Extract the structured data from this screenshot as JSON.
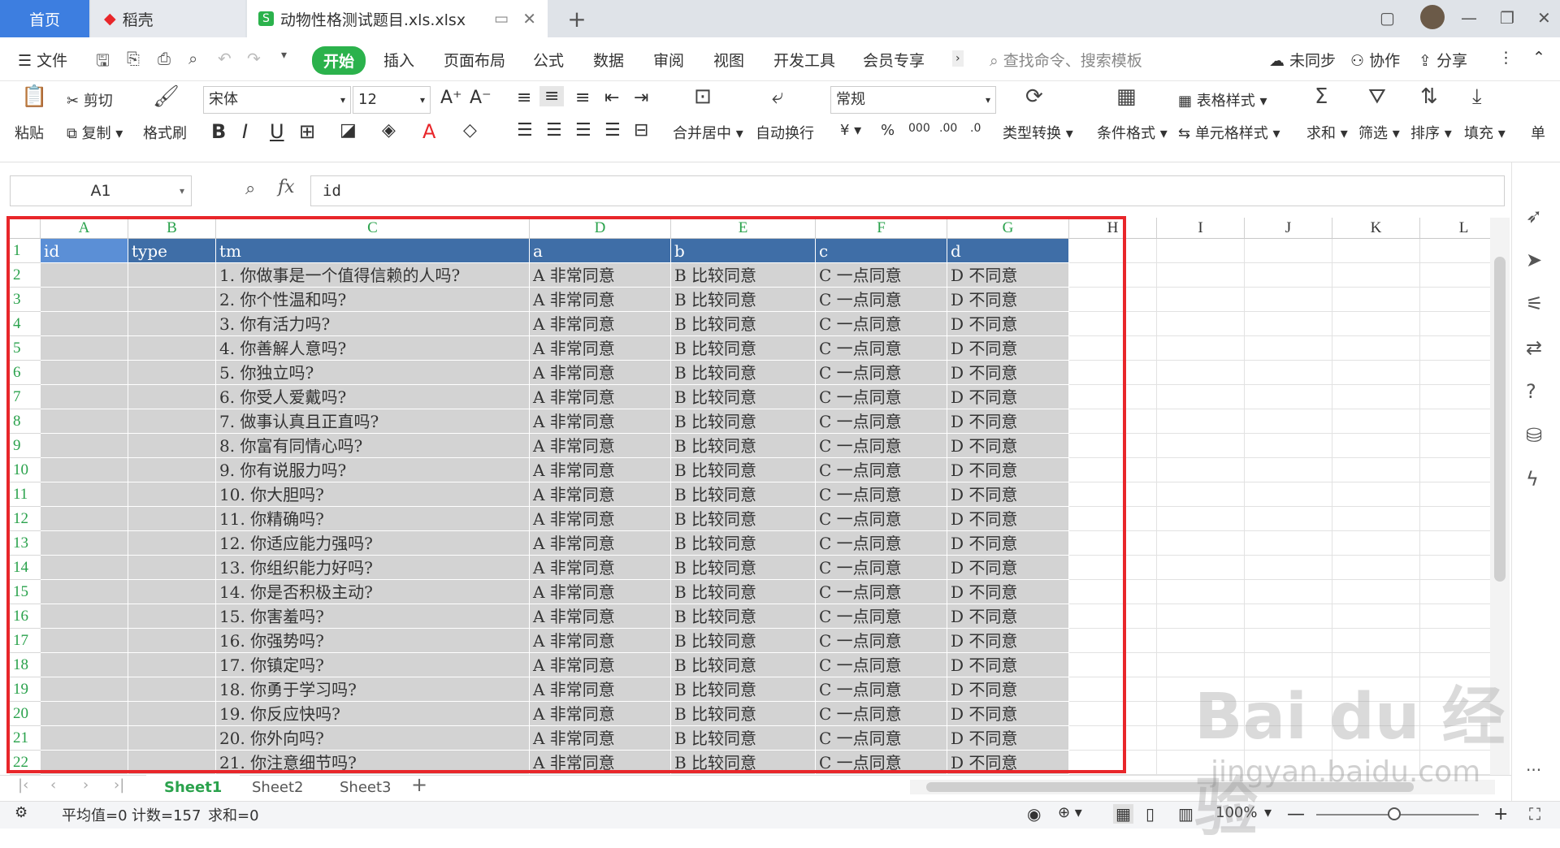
{
  "tabs": {
    "home": "首页",
    "daoke": "稻壳",
    "file": "动物性格测试题目.xls.xlsx"
  },
  "menu": {
    "file": "文件",
    "items": [
      "开始",
      "插入",
      "页面布局",
      "公式",
      "数据",
      "审阅",
      "视图",
      "开发工具",
      "会员专享"
    ],
    "search": "查找命令、搜索模板",
    "sync": "未同步",
    "collab": "协作",
    "share": "分享"
  },
  "ribbon": {
    "paste": "粘贴",
    "cut": "剪切",
    "copy": "复制",
    "format_painter": "格式刷",
    "font": "宋体",
    "size": "12",
    "merge": "合并居中",
    "wrap": "自动换行",
    "numfmt": "常规",
    "convert": "类型转换",
    "cond": "条件格式",
    "table_style": "表格样式",
    "cell_style": "单元格样式",
    "sum": "求和",
    "filter": "筛选",
    "sort": "排序",
    "fill": "填充",
    "more": "单"
  },
  "formula": {
    "cell_ref": "A1",
    "fx": "fx",
    "value": "id"
  },
  "columns": [
    "A",
    "B",
    "C",
    "D",
    "E",
    "F",
    "G",
    "H",
    "I",
    "J",
    "K",
    "L"
  ],
  "header_row": [
    "id",
    "type",
    "tm",
    "a",
    "b",
    "c",
    "d"
  ],
  "questions": [
    "1. 你做事是一个值得信赖的人吗?",
    "2. 你个性温和吗?",
    "3. 你有活力吗?",
    "4. 你善解人意吗?",
    "5. 你独立吗?",
    "6. 你受人爱戴吗?",
    "7. 做事认真且正直吗?",
    "8. 你富有同情心吗?",
    "9. 你有说服力吗?",
    "10. 你大胆吗?",
    "11. 你精确吗?",
    "12. 你适应能力强吗?",
    "13. 你组织能力好吗?",
    "14. 你是否积极主动?",
    "15. 你害羞吗?",
    "16. 你强势吗?",
    "17. 你镇定吗?",
    "18. 你勇于学习吗?",
    "19. 你反应快吗?",
    "20. 你外向吗?",
    "21. 你注意细节吗?"
  ],
  "options": [
    "A 非常同意",
    "B 比较同意",
    "C 一点同意",
    "D 不同意"
  ],
  "row_numbers": [
    "1",
    "2",
    "3",
    "4",
    "5",
    "6",
    "7",
    "8",
    "9",
    "10",
    "11",
    "12",
    "13",
    "14",
    "15",
    "16",
    "17",
    "18",
    "19",
    "20",
    "21",
    "22"
  ],
  "sheets": [
    "Sheet1",
    "Sheet2",
    "Sheet3"
  ],
  "status": {
    "avg": "平均值=0",
    "count": "计数=157",
    "sum": "求和=0",
    "zoom": "100%"
  },
  "watermark": {
    "brand": "Bai du 经验",
    "url": "jingyan.baidu.com"
  }
}
